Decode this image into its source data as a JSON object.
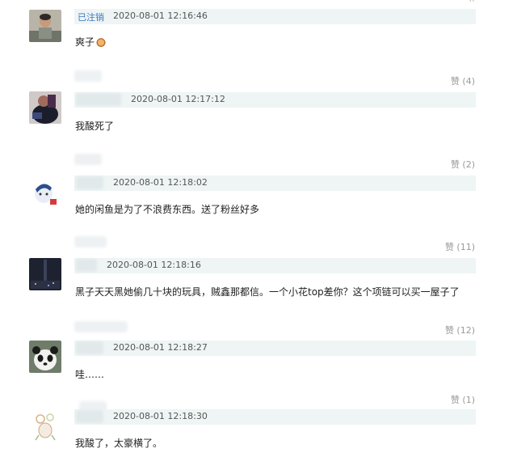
{
  "comments": [
    {
      "author": "已注销",
      "time": "2020-08-01 12:16:46",
      "text": "爽子",
      "likes": "",
      "avatar_icon": "person-photo-avatar"
    },
    {
      "author": "",
      "time": "2020-08-01 12:17:12",
      "text": "我酸死了",
      "likes": "赞 (4)",
      "avatar_icon": "person-photo-avatar"
    },
    {
      "author": "",
      "time": "2020-08-01 12:18:02",
      "text": "她的闲鱼是为了不浪费东西。送了粉丝好多",
      "likes": "赞 (2)",
      "avatar_icon": "cartoon-avatar"
    },
    {
      "author": "",
      "time": "2020-08-01 12:18:16",
      "text": "黑子天天黑她偷几十块的玩具，贼鑫那都信。一个小花top差你？这个项链可以买一屋子了",
      "likes": "赞 (11)",
      "avatar_icon": "night-city-avatar"
    },
    {
      "author": "",
      "time": "2020-08-01 12:18:27",
      "text": "哇……",
      "likes": "赞 (12)",
      "avatar_icon": "panda-avatar"
    },
    {
      "author": "",
      "time": "2020-08-01 12:18:30",
      "text": "我酸了，太豪横了。",
      "likes": "赞 (1)",
      "avatar_icon": "flower-avatar"
    }
  ]
}
